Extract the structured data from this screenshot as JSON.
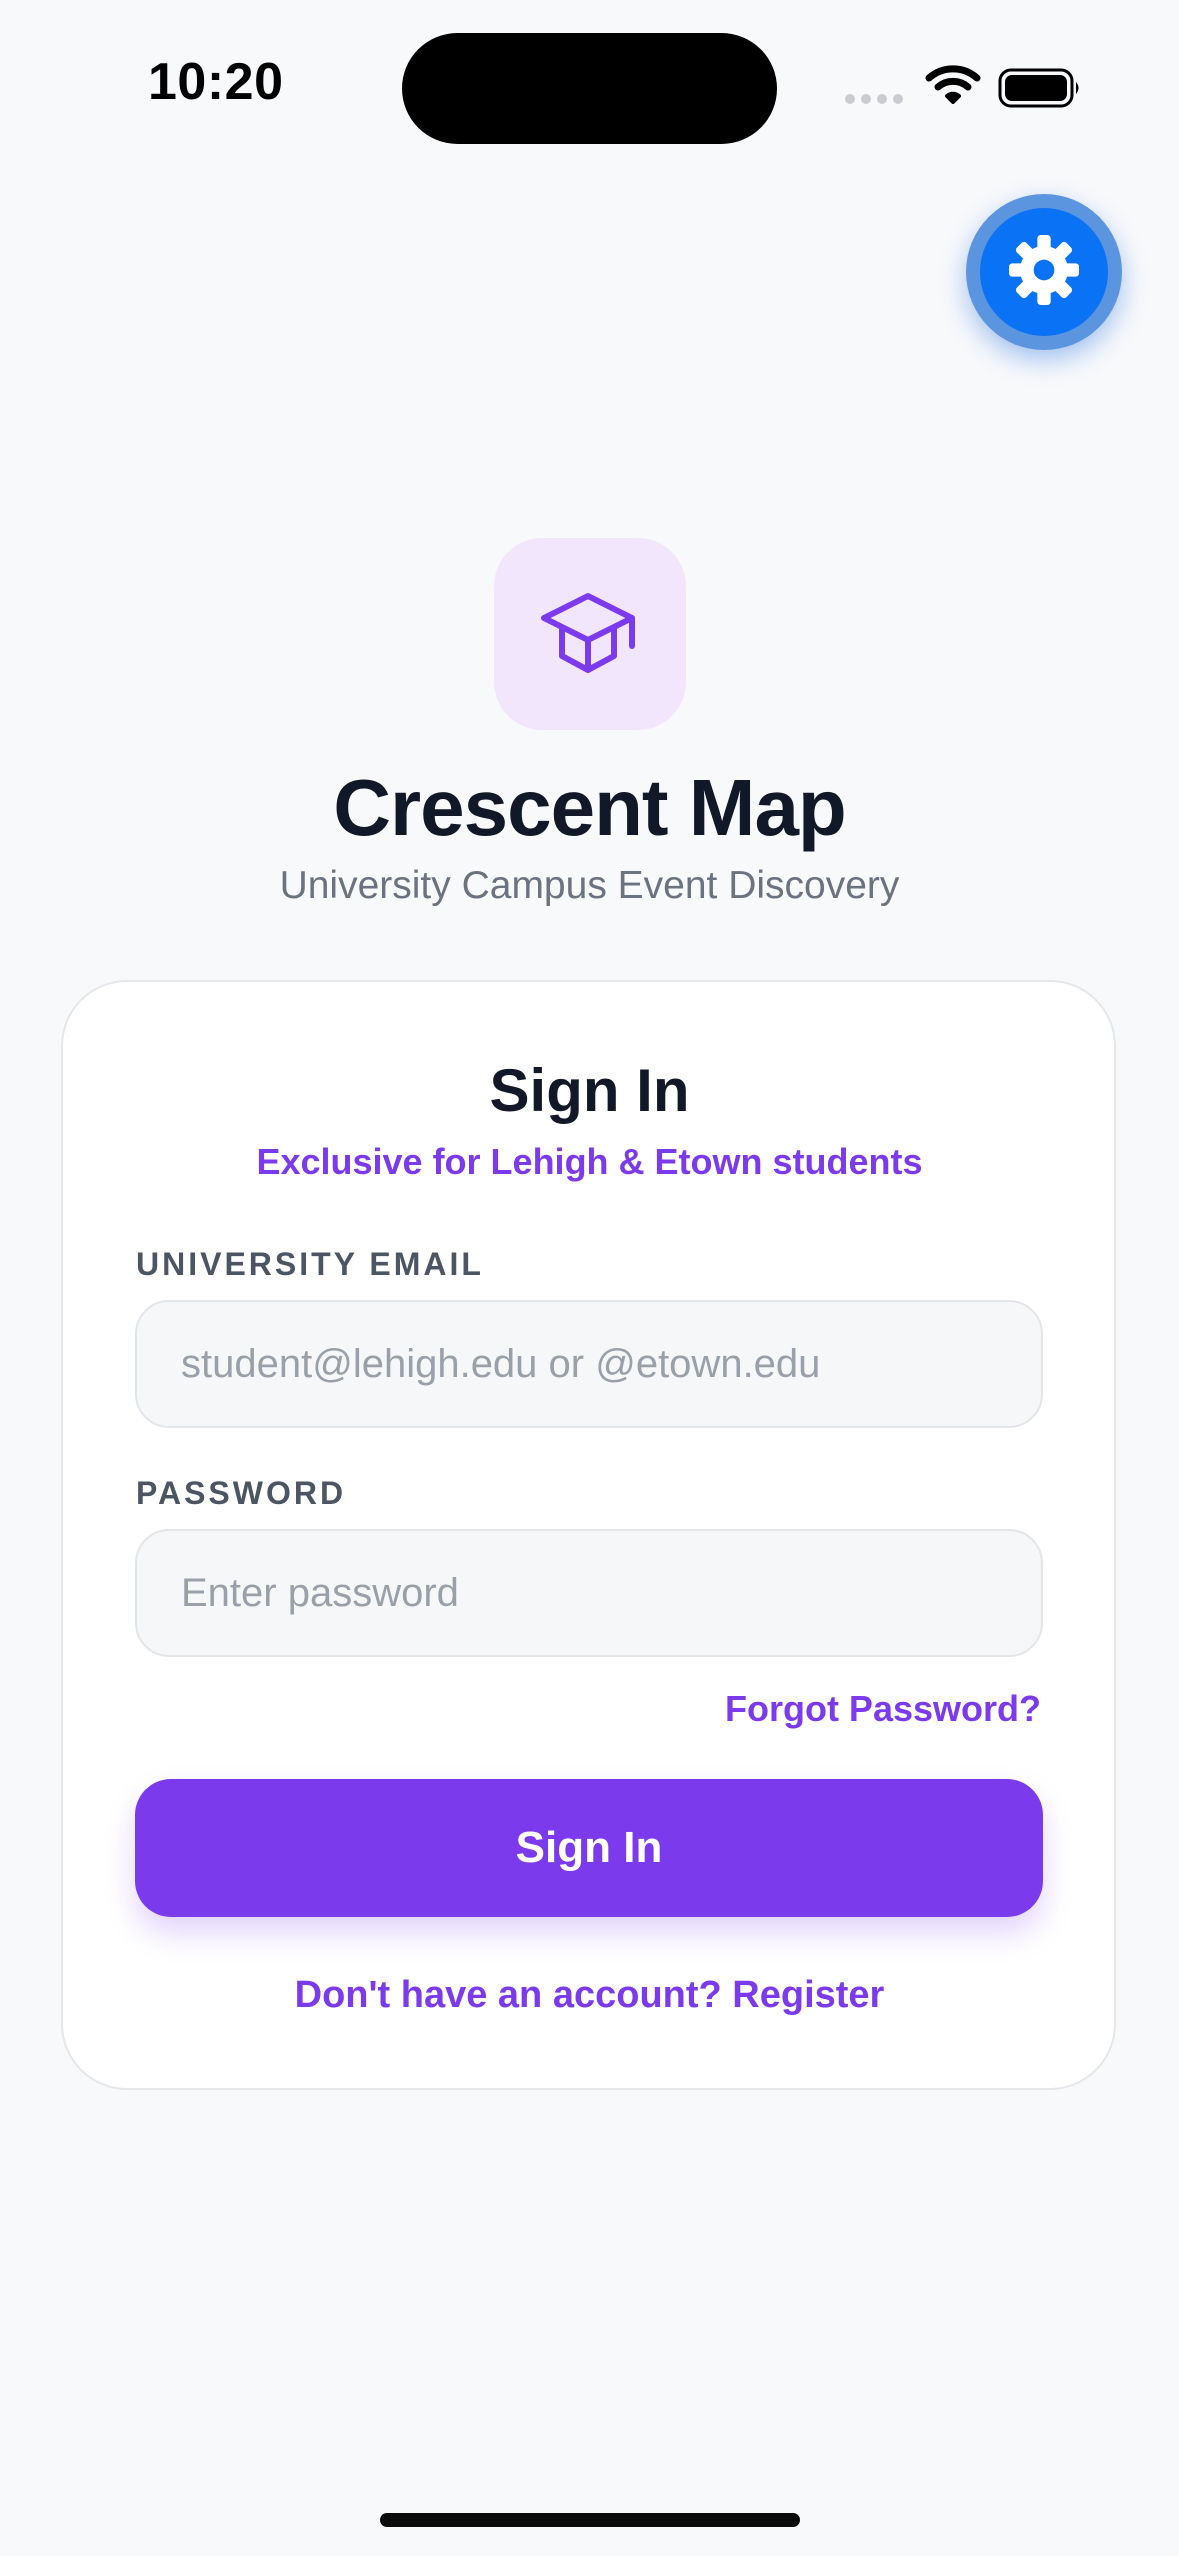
{
  "status_bar": {
    "time": "10:20",
    "icons": [
      "signal-icon",
      "wifi-icon",
      "battery-icon"
    ]
  },
  "settings_button": {
    "icon": "gear-icon"
  },
  "logo": {
    "icon": "graduation-cap-icon"
  },
  "app": {
    "title": "Crescent Map",
    "subtitle": "University Campus Event Discovery"
  },
  "signin_card": {
    "title": "Sign In",
    "subtitle": "Exclusive for Lehigh & Etown students",
    "email_label": "UNIVERSITY EMAIL",
    "email_placeholder": "student@lehigh.edu or @etown.edu",
    "email_value": "",
    "password_label": "PASSWORD",
    "password_placeholder": "Enter password",
    "password_value": "",
    "forgot_password": "Forgot Password?",
    "submit_label": "Sign In",
    "register_link": "Don't have an account? Register"
  },
  "colors": {
    "accent": "#7c3aed",
    "settings_blue": "#0a72f5",
    "background": "#f8f9fb",
    "logo_tile": "#f2e6fd"
  }
}
